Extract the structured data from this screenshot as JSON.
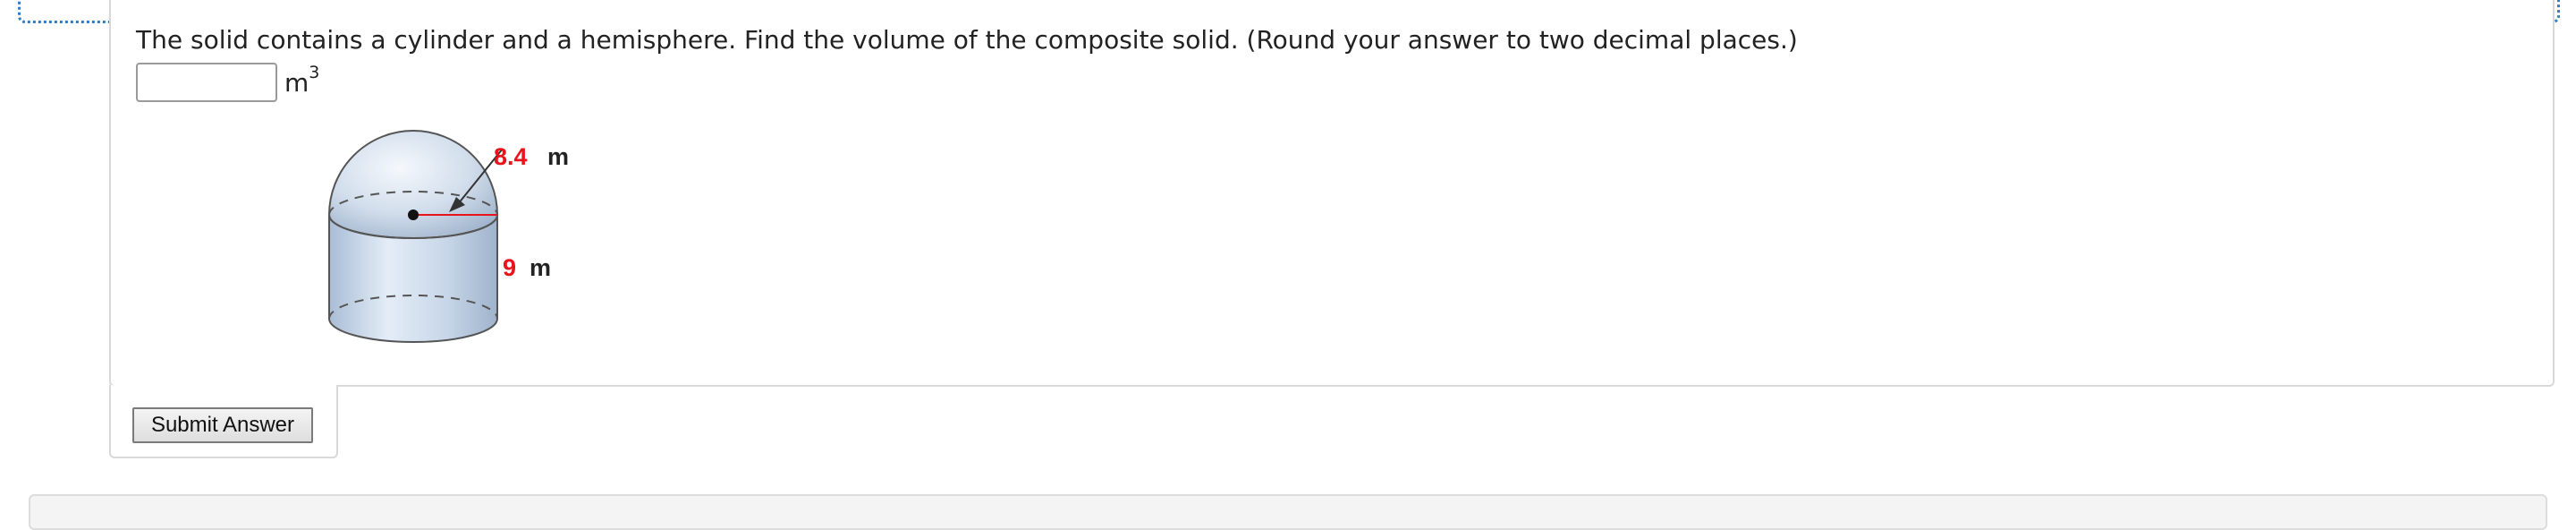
{
  "question": {
    "text": "The solid contains a cylinder and a hemisphere. Find the volume of the composite solid. (Round your answer to two decimal places.)"
  },
  "answer": {
    "value": "",
    "unit_base": "m",
    "unit_exponent": "3"
  },
  "figure": {
    "radius_value": "8.4",
    "radius_unit": "m",
    "height_value": "9",
    "height_unit": "m",
    "label_color": "#e8141b"
  },
  "submit": {
    "label": "Submit Answer"
  }
}
